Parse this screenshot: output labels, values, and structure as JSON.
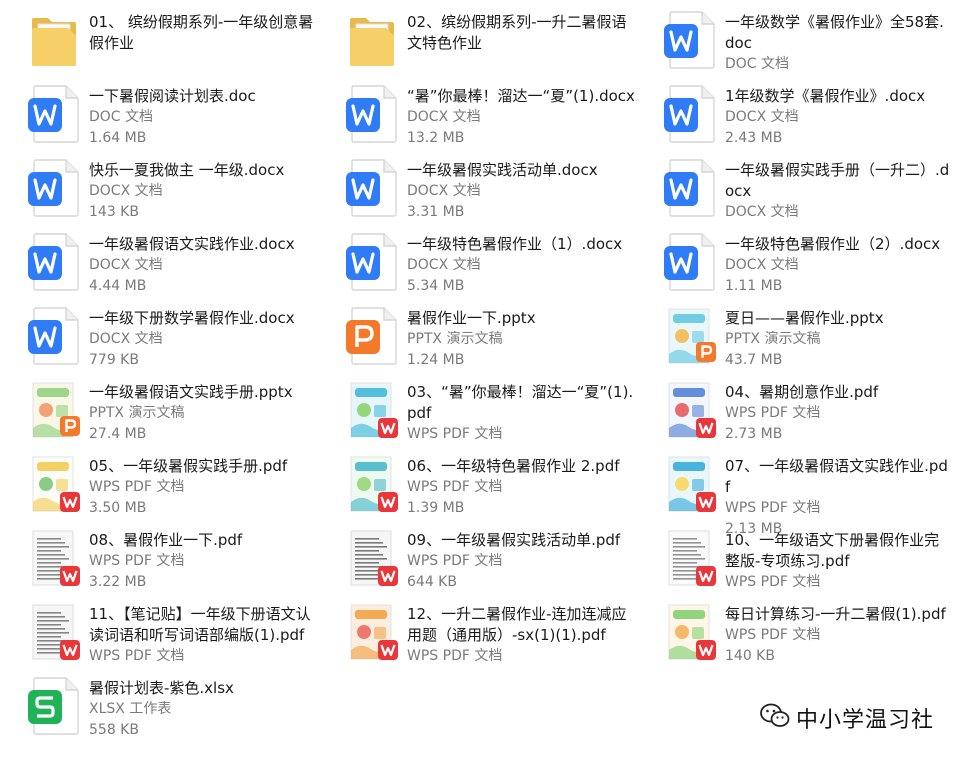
{
  "files": [
    {
      "name": "01、 缤纷假期系列-一年级创意暑假作业",
      "type": "",
      "size": "",
      "icon": "folder-icon"
    },
    {
      "name": "02、缤纷假期系列-一升二暑假语文特色作业",
      "type": "",
      "size": "",
      "icon": "folder-icon"
    },
    {
      "name": "一年级数学《暑假作业》全58套.doc",
      "type": "DOC 文档",
      "size": "",
      "icon": "wps-writer-icon"
    },
    {
      "name": "一下暑假阅读计划表.doc",
      "type": "DOC 文档",
      "size": "1.64 MB",
      "icon": "wps-writer-icon"
    },
    {
      "name": "“暑”你最棒！溜达一“夏”(1).docx",
      "type": "DOCX 文档",
      "size": "13.2 MB",
      "icon": "wps-writer-icon"
    },
    {
      "name": "1年级数学《暑假作业》.docx",
      "type": "DOCX 文档",
      "size": "2.43 MB",
      "icon": "wps-writer-icon"
    },
    {
      "name": "快乐一夏我做主 一年级.docx",
      "type": "DOCX 文档",
      "size": "143 KB",
      "icon": "wps-writer-icon"
    },
    {
      "name": "一年级暑假实践活动单.docx",
      "type": "DOCX 文档",
      "size": "3.31 MB",
      "icon": "wps-writer-icon"
    },
    {
      "name": "一年级暑假实践手册（一升二）.docx",
      "type": "DOCX 文档",
      "size": "",
      "icon": "wps-writer-icon"
    },
    {
      "name": "一年级暑假语文实践作业.docx",
      "type": "DOCX 文档",
      "size": "4.44 MB",
      "icon": "wps-writer-icon"
    },
    {
      "name": "一年级特色暑假作业（1）.docx",
      "type": "DOCX 文档",
      "size": "5.34 MB",
      "icon": "wps-writer-icon"
    },
    {
      "name": "一年级特色暑假作业（2）.docx",
      "type": "DOCX 文档",
      "size": "1.11 MB",
      "icon": "wps-writer-icon"
    },
    {
      "name": "一年级下册数学暑假作业.docx",
      "type": "DOCX 文档",
      "size": "779 KB",
      "icon": "wps-writer-icon"
    },
    {
      "name": "暑假作业一下.pptx",
      "type": "PPTX 演示文稿",
      "size": "1.24 MB",
      "icon": "wps-presentation-icon"
    },
    {
      "name": "夏日——暑假作业.pptx",
      "type": "PPTX 演示文稿",
      "size": "43.7 MB",
      "icon": "pptx-thumbnail-icon"
    },
    {
      "name": "一年级暑假语文实践手册.pptx",
      "type": "PPTX 演示文稿",
      "size": "27.4 MB",
      "icon": "pptx-thumbnail-icon"
    },
    {
      "name": "03、“暑”你最棒！溜达一“夏”(1).pdf",
      "type": "WPS PDF 文档",
      "size": "",
      "icon": "pdf-thumbnail-icon"
    },
    {
      "name": "04、暑期创意作业.pdf",
      "type": "WPS PDF 文档",
      "size": "2.73 MB",
      "icon": "pdf-thumbnail-icon"
    },
    {
      "name": "05、一年级暑假实践手册.pdf",
      "type": "WPS PDF 文档",
      "size": "3.50 MB",
      "icon": "pdf-thumbnail-icon"
    },
    {
      "name": "06、一年级特色暑假作业 2.pdf",
      "type": "WPS PDF 文档",
      "size": "1.39 MB",
      "icon": "pdf-thumbnail-icon"
    },
    {
      "name": "07、一年级暑假语文实践作业.pdf",
      "type": "WPS PDF 文档",
      "size": "2.13 MB",
      "icon": "pdf-thumbnail-icon"
    },
    {
      "name": "08、暑假作业一下.pdf",
      "type": "WPS PDF 文档",
      "size": "3.22 MB",
      "icon": "pdf-thumbnail-icon"
    },
    {
      "name": "09、一年级暑假实践活动单.pdf",
      "type": "WPS PDF 文档",
      "size": "644 KB",
      "icon": "pdf-thumbnail-icon"
    },
    {
      "name": "10、一年级语文下册暑假作业完整版-专项练习.pdf",
      "type": "WPS PDF 文档",
      "size": "",
      "icon": "pdf-thumbnail-icon"
    },
    {
      "name": "11、【笔记贴】一年级下册语文认读词语和听写词语部编版(1).pdf",
      "type": "WPS PDF 文档",
      "size": "",
      "icon": "pdf-thumbnail-icon"
    },
    {
      "name": "12、一升二暑假作业-连加连减应用题（通用版）-sx(1)(1).pdf",
      "type": "WPS PDF 文档",
      "size": "",
      "icon": "pdf-thumbnail-icon"
    },
    {
      "name": "每日计算练习-一升二暑假(1).pdf",
      "type": "WPS PDF 文档",
      "size": "140 KB",
      "icon": "pdf-thumbnail-icon"
    },
    {
      "name": "暑假计划表-紫色.xlsx",
      "type": "XLSX 工作表",
      "size": "558 KB",
      "icon": "wps-spreadsheet-icon"
    }
  ],
  "thumb_palettes": [
    [
      "#e9f7fb",
      "#5cc4e0",
      "#f4b23c"
    ],
    [
      "#fbf7e6",
      "#8bcf7a",
      "#f18b5a"
    ],
    [
      "#e6f6fb",
      "#37b5d9",
      "#7ed05a"
    ],
    [
      "#f3f6fa",
      "#4a7bd4",
      "#e24b4b"
    ],
    [
      "#fdfdf7",
      "#f1c84a",
      "#6bbf6b"
    ],
    [
      "#eef9f0",
      "#3fb5c6",
      "#8bd36a"
    ],
    [
      "#e8f7fb",
      "#2ea7d6",
      "#fbd34a"
    ],
    [
      "#f7f7f7",
      "#8a8a8a",
      "#5a5a5a"
    ],
    [
      "#f5f5f5",
      "#777777",
      "#444444"
    ],
    [
      "#fafafa",
      "#999999",
      "#666666"
    ],
    [
      "#f6f6f6",
      "#888888",
      "#555555"
    ],
    [
      "#fbeee0",
      "#f29c3c",
      "#e85d4d"
    ],
    [
      "#fff6e8",
      "#7ccf6a",
      "#f0a94a"
    ]
  ],
  "watermark": {
    "text": "中小学温习社",
    "icon": "wechat-icon"
  }
}
